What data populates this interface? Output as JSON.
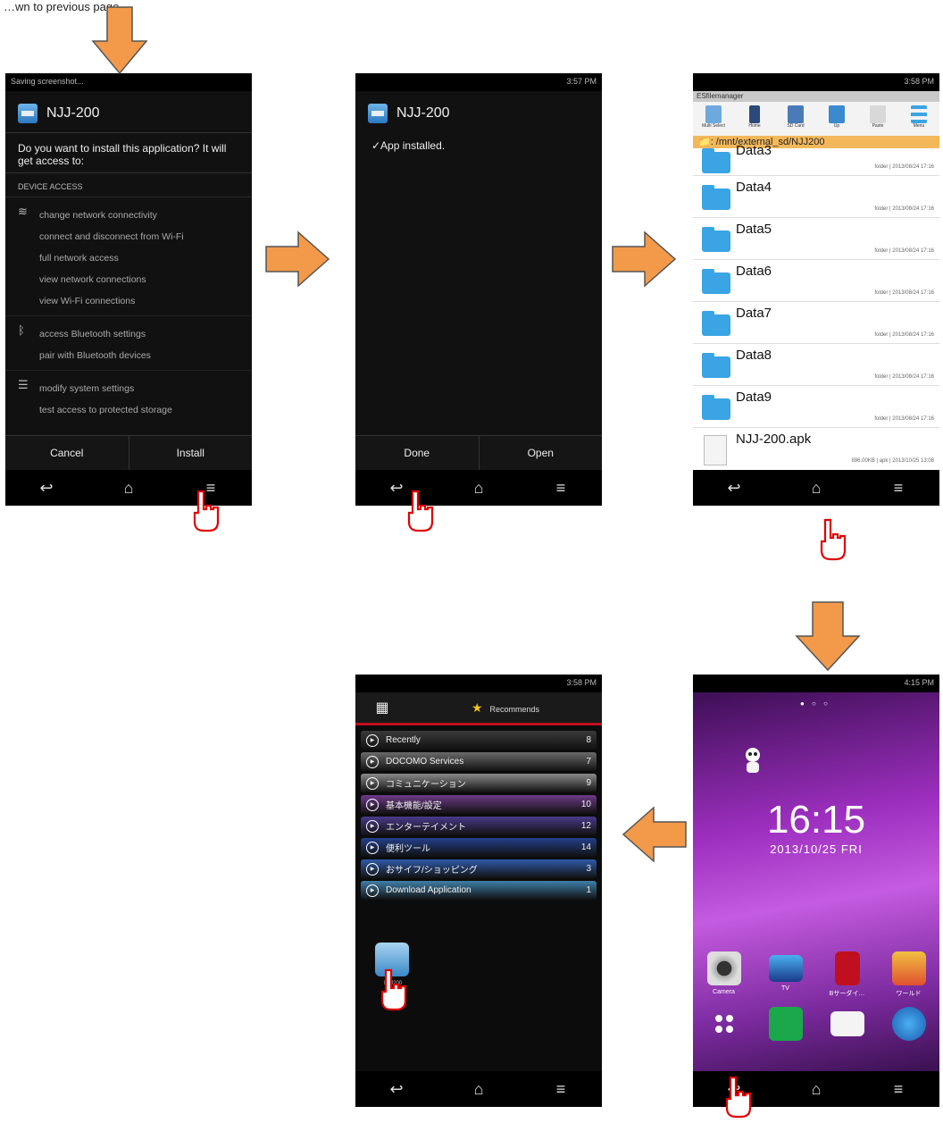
{
  "caption": "…wn to previous page",
  "colors": {
    "arrow": "#f39a4a",
    "arrow_stroke": "#555555",
    "hand": "#e00000"
  },
  "screen1": {
    "status_left": "Saving screenshot...",
    "app_name": "NJJ-200",
    "question": "Do you want to install this application? It will get access to:",
    "section": "DEVICE ACCESS",
    "groups": [
      {
        "icon": "wifi-icon",
        "items": [
          "change network connectivity",
          "connect and disconnect from Wi-Fi",
          "full network access",
          "view network connections",
          "view Wi-Fi connections"
        ]
      },
      {
        "icon": "bluetooth-icon",
        "items": [
          "access Bluetooth settings",
          "pair with Bluetooth devices"
        ]
      },
      {
        "icon": "settings-icon",
        "items": [
          "modify system settings",
          "test access to protected storage"
        ]
      }
    ],
    "cancel": "Cancel",
    "install": "Install"
  },
  "screen2": {
    "time": "3:57 PM",
    "app_name": "NJJ-200",
    "message": "✓App installed.",
    "done": "Done",
    "open": "Open"
  },
  "screen3": {
    "time": "3:58 PM",
    "app_title": "ESfilemanager",
    "tools": [
      "Multi Select",
      "Home",
      "SD Card",
      "Up",
      "Paste",
      "Menu"
    ],
    "path": "📁: /mnt/external_sd/NJJ200",
    "folders": [
      {
        "name": "Data3",
        "meta": "folder | 2013/08/24 17:16"
      },
      {
        "name": "Data4",
        "meta": "folder | 2013/08/24 17:16"
      },
      {
        "name": "Data5",
        "meta": "folder | 2013/08/24 17:16"
      },
      {
        "name": "Data6",
        "meta": "folder | 2013/08/24 17:16"
      },
      {
        "name": "Data7",
        "meta": "folder | 2013/08/24 17:16"
      },
      {
        "name": "Data8",
        "meta": "folder | 2013/08/24 17:16"
      },
      {
        "name": "Data9",
        "meta": "folder | 2013/08/24 17:16"
      }
    ],
    "apk": {
      "name": "NJJ-200.apk",
      "meta": "896.00KB | apk | 2013/10/25 13:08"
    }
  },
  "screen4": {
    "time": "3:58 PM",
    "tab_label": "Recommends",
    "categories": [
      {
        "label": "Recently",
        "count": "8",
        "color": "#3a3a3a"
      },
      {
        "label": "DOCOMO Services",
        "count": "7",
        "color": "#6a6a6a"
      },
      {
        "label": "コミュニケーション",
        "count": "9",
        "color": "#8a8a8a"
      },
      {
        "label": "基本機能/設定",
        "count": "10",
        "color": "#6e3a8a"
      },
      {
        "label": "エンターテイメント",
        "count": "12",
        "color": "#4a3a8a"
      },
      {
        "label": "便利ツール",
        "count": "14",
        "color": "#233f8a"
      },
      {
        "label": "おサイフ/ショッピング",
        "count": "3",
        "color": "#2f5aa8"
      },
      {
        "label": "Download Application",
        "count": "1",
        "color": "#3f7fa8"
      }
    ],
    "app_label": "NJJ200"
  },
  "screen5": {
    "time": "4:15 PM",
    "clock": "16:15",
    "date": "2013/10/25  FRI",
    "dock_row1": [
      {
        "label": "Camera",
        "icon": "camera-icon"
      },
      {
        "label": "TV",
        "icon": "tv-icon"
      },
      {
        "label": "Bサーダイ…",
        "icon": "bookmark-icon"
      },
      {
        "label": "ワールド",
        "icon": "game-icon"
      }
    ],
    "dock_row2": [
      {
        "label": "",
        "icon": "app-drawer-icon"
      },
      {
        "label": "",
        "icon": "phone-icon"
      },
      {
        "label": "",
        "icon": "mail-icon"
      },
      {
        "label": "",
        "icon": "browser-icon"
      }
    ]
  }
}
